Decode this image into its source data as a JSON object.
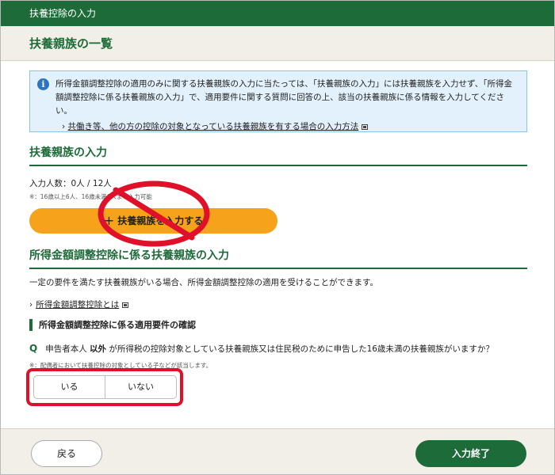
{
  "window": {
    "title": "扶養控除の入力"
  },
  "page": {
    "heading": "扶養親族の一覧"
  },
  "info": {
    "icon": "info-icon",
    "text": "所得金額調整控除の適用のみに関する扶養親族の入力に当たっては、「扶養親族の入力」には扶養親族を入力せず、「所得金額調整控除に係る扶養親族の入力」で、適用要件に関する質問に回答の上、該当の扶養親族に係る情報を入力してください。",
    "link_label": "共働き等、他の方の控除の対象となっている扶養親族を有する場合の入力方法"
  },
  "dependents": {
    "heading": "扶養親族の入力",
    "count_text": "入力人数：0人 / 12人",
    "note": "※：16歳以上6人、16歳未満6人まで入力可能",
    "add_label": "扶養親族を入力する",
    "add_icon": "plus-icon",
    "prohibited_mark": "prohibited-icon"
  },
  "adjustment": {
    "heading": "所得金額調整控除に係る扶養親族の入力",
    "description": "一定の要件を満たす扶養親族がいる場合、所得金額調整控除の適用を受けることができます。",
    "link_label": "所得金額調整控除とは",
    "subheading": "所得金額調整控除に係る適用要件の確認",
    "q_mark": "Q",
    "q_pre": "申告者本人",
    "q_emphasis": "以外",
    "q_post": "が所得税の控除対象としている扶養親族又は住民税のために申告した16歳未満の扶養親族がいますか？",
    "q_note": "※：配偶者において扶養控除の対象としている子などが該当します。",
    "choices": [
      "いる",
      "いない"
    ]
  },
  "footer": {
    "back_label": "戻る",
    "done_label": "入力終了"
  },
  "colors": {
    "brand_green": "#1e6b3a",
    "accent_orange": "#f6a21b",
    "highlight_red": "#e0102a",
    "info_blue": "#2a74c3"
  }
}
